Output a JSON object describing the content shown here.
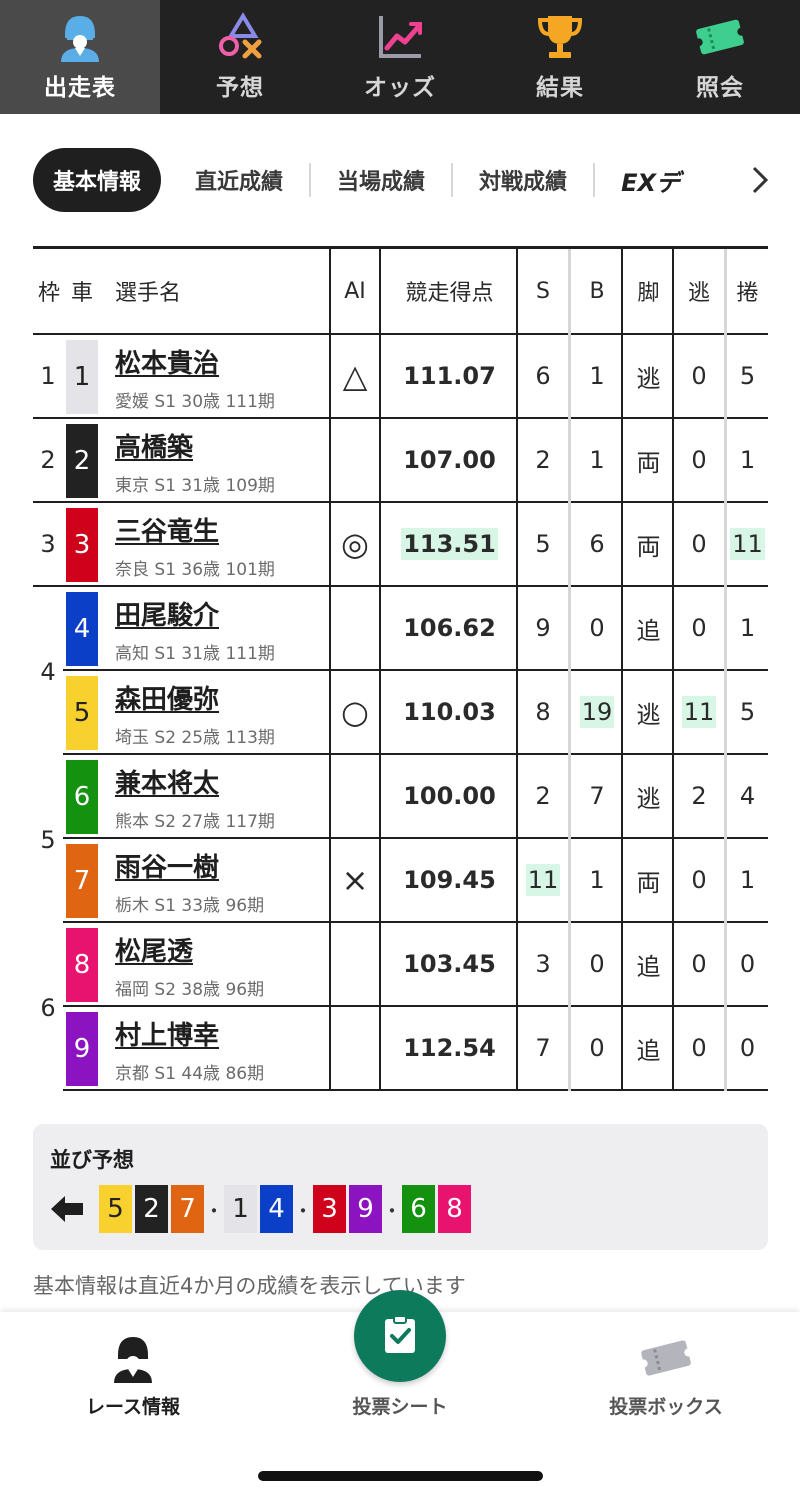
{
  "top_nav": [
    {
      "label": "出走表",
      "icon": "racer-icon",
      "active": true
    },
    {
      "label": "予想",
      "icon": "prediction-symbols-icon",
      "active": false
    },
    {
      "label": "オッズ",
      "icon": "odds-chart-icon",
      "active": false
    },
    {
      "label": "結果",
      "icon": "trophy-icon",
      "active": false
    },
    {
      "label": "照会",
      "icon": "ticket-icon",
      "active": false
    }
  ],
  "sub_tabs": {
    "active": "基本情報",
    "items": [
      "直近成績",
      "当場成績",
      "対戦成績",
      "EXデ"
    ]
  },
  "table": {
    "headers": {
      "waku": "枠",
      "car": "車",
      "name": "選手名",
      "ai": "AI",
      "score": "競走得点",
      "s": "S",
      "b": "B",
      "leg": "脚",
      "nige": "逃",
      "makuri": "捲"
    },
    "rows": [
      {
        "waku": "1",
        "car": "1",
        "name": "松本貴治",
        "info": "愛媛 S1 30歳 111期",
        "ai": "△",
        "score": "111.07",
        "s": "6",
        "b": "1",
        "leg": "逃",
        "nige": "0",
        "makuri": "5"
      },
      {
        "waku": "2",
        "car": "2",
        "name": "高橋築",
        "info": "東京 S1 31歳 109期",
        "ai": "",
        "score": "107.00",
        "s": "2",
        "b": "1",
        "leg": "両",
        "nige": "0",
        "makuri": "1"
      },
      {
        "waku": "3",
        "car": "3",
        "name": "三谷竜生",
        "info": "奈良 S1 36歳 101期",
        "ai": "◎",
        "score": "113.51",
        "s": "5",
        "b": "6",
        "leg": "両",
        "nige": "0",
        "makuri": "11"
      },
      {
        "waku": "4",
        "car": "4",
        "name": "田尾駿介",
        "info": "高知 S1 31歳 111期",
        "ai": "",
        "score": "106.62",
        "s": "9",
        "b": "0",
        "leg": "追",
        "nige": "0",
        "makuri": "1"
      },
      {
        "waku": "",
        "car": "5",
        "name": "森田優弥",
        "info": "埼玉 S2 25歳 113期",
        "ai": "○",
        "score": "110.03",
        "s": "8",
        "b": "19",
        "leg": "逃",
        "nige": "11",
        "makuri": "5"
      },
      {
        "waku": "5",
        "car": "6",
        "name": "兼本将太",
        "info": "熊本 S2 27歳 117期",
        "ai": "",
        "score": "100.00",
        "s": "2",
        "b": "7",
        "leg": "逃",
        "nige": "2",
        "makuri": "4"
      },
      {
        "waku": "",
        "car": "7",
        "name": "雨谷一樹",
        "info": "栃木 S1 33歳 96期",
        "ai": "×",
        "score": "109.45",
        "s": "11",
        "b": "1",
        "leg": "両",
        "nige": "0",
        "makuri": "1"
      },
      {
        "waku": "6",
        "car": "8",
        "name": "松尾透",
        "info": "福岡 S2 38歳 96期",
        "ai": "",
        "score": "103.45",
        "s": "3",
        "b": "0",
        "leg": "追",
        "nige": "0",
        "makuri": "0"
      },
      {
        "waku": "",
        "car": "9",
        "name": "村上博幸",
        "info": "京都 S1 44歳 86期",
        "ai": "",
        "score": "112.54",
        "s": "7",
        "b": "0",
        "leg": "追",
        "nige": "0",
        "makuri": "0"
      }
    ]
  },
  "car_colors": {
    "1": {
      "bg": "#e4e4e8",
      "fg": "#222222"
    },
    "2": {
      "bg": "#222222",
      "fg": "#ffffff"
    },
    "3": {
      "bg": "#d0021b",
      "fg": "#ffffff"
    },
    "4": {
      "bg": "#0b3fc8",
      "fg": "#ffffff"
    },
    "5": {
      "bg": "#f8d12f",
      "fg": "#222222"
    },
    "6": {
      "bg": "#14910f",
      "fg": "#ffffff"
    },
    "7": {
      "bg": "#e06512",
      "fg": "#ffffff"
    },
    "8": {
      "bg": "#e8136f",
      "fg": "#ffffff"
    },
    "9": {
      "bg": "#8c14c0",
      "fg": "#ffffff"
    }
  },
  "highlight_color": "#d8f6e6",
  "line_prediction": {
    "title": "並び予想",
    "sequence": [
      "5",
      "2",
      "7",
      "・",
      "1",
      "4",
      "・",
      "3",
      "9",
      "・",
      "6",
      "8"
    ]
  },
  "note": "基本情報は直近4か月の成績を表示しています",
  "bottom_nav": [
    {
      "label": "レース情報",
      "icon": "racer-icon",
      "active": true
    },
    {
      "label": "投票シート",
      "icon": "vote-sheet-check-icon",
      "active": false
    },
    {
      "label": "投票ボックス",
      "icon": "ticket-box-icon",
      "active": false
    }
  ]
}
